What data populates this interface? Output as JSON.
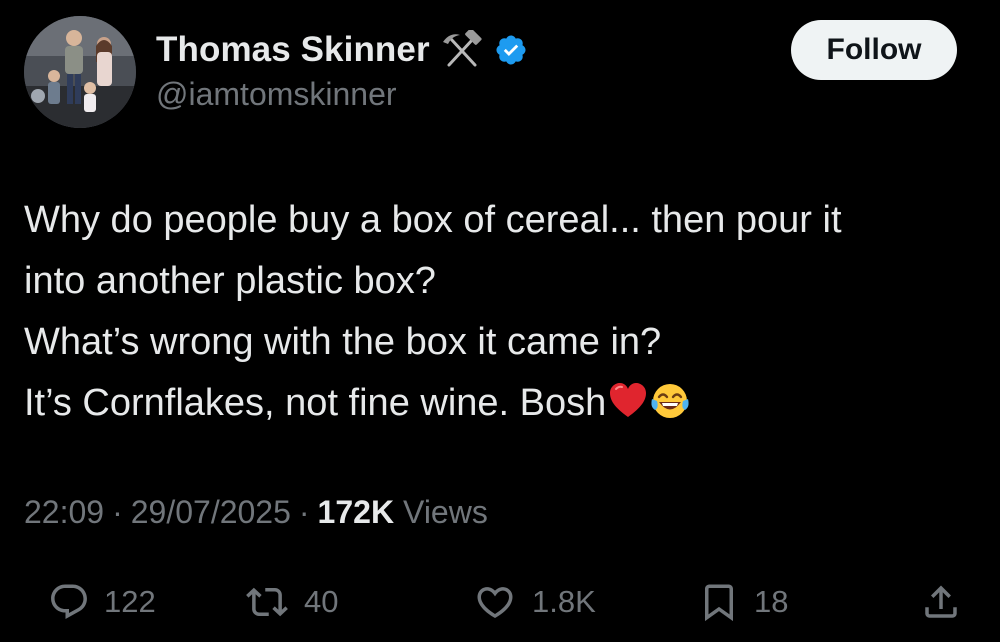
{
  "author": {
    "display_name": "Thomas Skinner",
    "handle": "@iamtomskinner",
    "badge_icons": [
      "hammer-pick-icon",
      "verified-badge-icon"
    ],
    "verified_color": "#1d9bf0"
  },
  "follow_button": {
    "label": "Follow"
  },
  "tweet": {
    "lines": [
      "Why do people buy a box of cereal... then pour it",
      "into another plastic box?",
      "What’s wrong with the box it came in?",
      "It’s Cornflakes, not fine wine. Bosh"
    ],
    "trailing_emoji": [
      "red-heart-emoji",
      "face-with-tears-of-joy-emoji"
    ]
  },
  "meta": {
    "time": "22:09",
    "date": "29/07/2025",
    "separator": "·",
    "views_count": "172K",
    "views_label": "Views"
  },
  "actions": {
    "replies": "122",
    "reposts": "40",
    "likes": "1.8K",
    "bookmarks": "18"
  },
  "colors": {
    "background": "#000000",
    "text_primary": "#e7e9ea",
    "text_secondary": "#71767b",
    "follow_bg": "#eff3f4"
  }
}
